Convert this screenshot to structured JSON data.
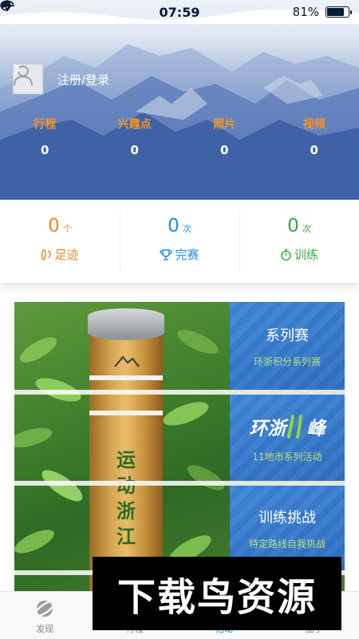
{
  "status_bar": {
    "time": "07:59",
    "battery_percent": "81%",
    "battery_level": 0.81,
    "icons": [
      "airplane-icon",
      "wifi-icon",
      "location-arrow-icon",
      "orientation-lock-icon"
    ]
  },
  "profile": {
    "login_label": "注册/登录",
    "avatar_icon": "person-icon"
  },
  "stats": [
    {
      "label": "行程",
      "value": "0"
    },
    {
      "label": "兴趣点",
      "value": "0"
    },
    {
      "label": "照片",
      "value": "0"
    },
    {
      "label": "视频",
      "value": "0"
    }
  ],
  "summary": [
    {
      "value": "0",
      "unit": "个",
      "label": "足迹",
      "icon": "footprint-icon",
      "color": "#ef8a2a"
    },
    {
      "value": "0",
      "unit": "次",
      "label": "完赛",
      "icon": "trophy-icon",
      "color": "#1f8ee3"
    },
    {
      "value": "0",
      "unit": "次",
      "label": "训练",
      "icon": "stopwatch-icon",
      "color": "#37a744"
    }
  ],
  "banner": {
    "post_text": "运动浙江",
    "tiles": [
      {
        "title": "系列赛",
        "subtitle": "环浙积分系列赛"
      },
      {
        "logo_text_1": "环浙",
        "logo_text_2": "峰",
        "subtitle": "11地市系列活动"
      },
      {
        "title": "训练挑战",
        "subtitle": "特定路线自我挑战"
      }
    ]
  },
  "tabbar": {
    "tabs": [
      {
        "label": "发现",
        "icon": "planet-icon",
        "active": false
      },
      {
        "label": "行程",
        "icon": "route-icon",
        "active": false
      },
      {
        "label": "活动",
        "icon": "activity-icon",
        "active": true
      },
      {
        "label": "圈子",
        "icon": "group-icon",
        "active": false
      }
    ]
  },
  "watermark": {
    "text": "下载鸟资源"
  },
  "colors": {
    "accent_orange": "#f0962d",
    "accent_blue": "#1f8ee3",
    "accent_green": "#37a744"
  }
}
